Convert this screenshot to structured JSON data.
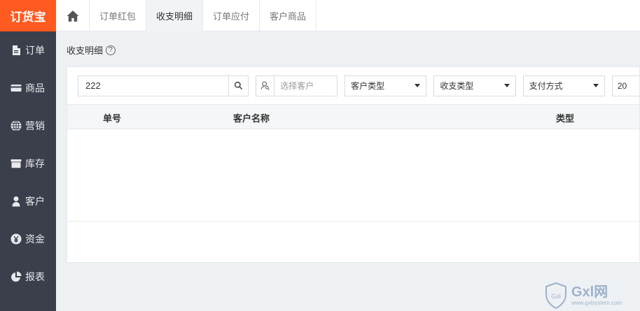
{
  "brand": {
    "logo_text": "订货宝",
    "color": "#ff5a1f"
  },
  "sidebar": {
    "items": [
      {
        "label": "订单",
        "icon": "document-icon"
      },
      {
        "label": "商品",
        "icon": "card-icon"
      },
      {
        "label": "营销",
        "icon": "globe-icon"
      },
      {
        "label": "库存",
        "icon": "box-icon"
      },
      {
        "label": "客户",
        "icon": "user-icon"
      },
      {
        "label": "资金",
        "icon": "yen-icon"
      },
      {
        "label": "报表",
        "icon": "pie-chart-icon"
      }
    ]
  },
  "tabs": [
    {
      "label": "订单红包",
      "active": false
    },
    {
      "label": "收支明细",
      "active": true
    },
    {
      "label": "订单应付",
      "active": false
    },
    {
      "label": "客户商品",
      "active": false
    }
  ],
  "page": {
    "title": "收支明细",
    "help": "?"
  },
  "filters": {
    "search_value": "222",
    "customer_placeholder": "选择客户",
    "customer_type": "客户类型",
    "income_type": "收支类型",
    "payment_method": "支付方式",
    "date_partial": "20"
  },
  "table": {
    "columns": [
      "单号",
      "客户名称",
      "类型"
    ]
  },
  "watermark": {
    "big": "Gxl网",
    "small": "www.gxlsystem.com",
    "shield": "Gxl"
  }
}
